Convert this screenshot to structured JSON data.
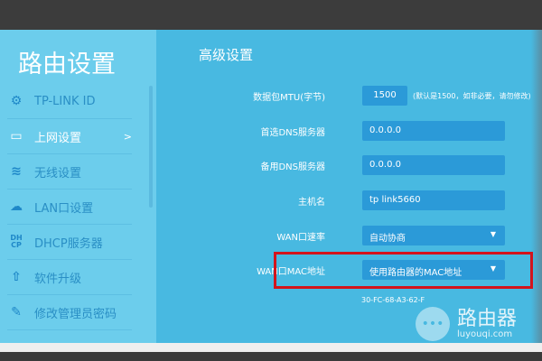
{
  "sidebar": {
    "title": "路由设置",
    "items": [
      {
        "label": "TP-LINK ID",
        "icon": "gear-icon"
      },
      {
        "label": "上网设置",
        "icon": "laptop-icon",
        "active": true,
        "arrow": ">"
      },
      {
        "label": "无线设置",
        "icon": "wifi-icon"
      },
      {
        "label": "LAN口设置",
        "icon": "cloud-network-icon"
      },
      {
        "label": "DHCP服务器",
        "icon": "dhcp-icon",
        "icon_text": "DH CP"
      },
      {
        "label": "软件升级",
        "icon": "upload-icon"
      },
      {
        "label": "修改管理员密码",
        "icon": "pencil-icon"
      }
    ]
  },
  "main": {
    "title": "高级设置",
    "mtu": {
      "label": "数据包MTU(字节)",
      "value": "1500",
      "hint": "(默认是1500，如非必要，请勿修改)"
    },
    "dns1": {
      "label": "首选DNS服务器",
      "value": "0.0.0.0"
    },
    "dns2": {
      "label": "备用DNS服务器",
      "value": "0.0.0.0"
    },
    "hostname": {
      "label": "主机名",
      "value": "tp link5660"
    },
    "wan_rate": {
      "label": "WAN口速率",
      "value": "自动协商"
    },
    "wan_mac": {
      "label": "WAN口MAC地址",
      "value": "使用路由器的MAC地址",
      "mac": "30-FC-68-A3-62-F"
    }
  },
  "watermark": {
    "name": "路由器",
    "url": "luyouqi.com"
  },
  "colors": {
    "sidebar": "#6ccdec",
    "main": "#48b9e1",
    "field": "#2b9ad8",
    "highlight": "#d3141c"
  }
}
